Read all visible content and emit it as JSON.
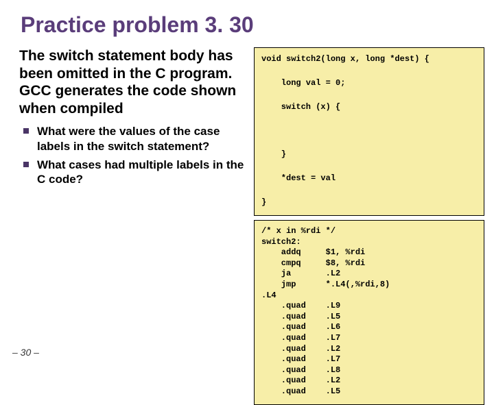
{
  "title": "Practice problem 3. 30",
  "paragraph": "The switch statement body has been omitted in the C program.  GCC generates the code shown when compiled",
  "bullets": [
    "What were the values of the case labels in the switch statement?",
    "What cases had multiple labels in the C code?"
  ],
  "code_c": "void switch2(long x, long *dest) {\n\n    long val = 0;\n\n    switch (x) {\n\n\n\n    }\n\n    *dest = val\n\n}",
  "code_asm": "/* x in %rdi */\nswitch2:\n    addq     $1, %rdi\n    cmpq     $8, %rdi\n    ja       .L2\n    jmp      *.L4(,%rdi,8)\n.L4\n    .quad    .L9\n    .quad    .L5\n    .quad    .L6\n    .quad    .L7\n    .quad    .L2\n    .quad    .L7\n    .quad    .L8\n    .quad    .L2\n    .quad    .L5",
  "pagenum": "– 30 –"
}
